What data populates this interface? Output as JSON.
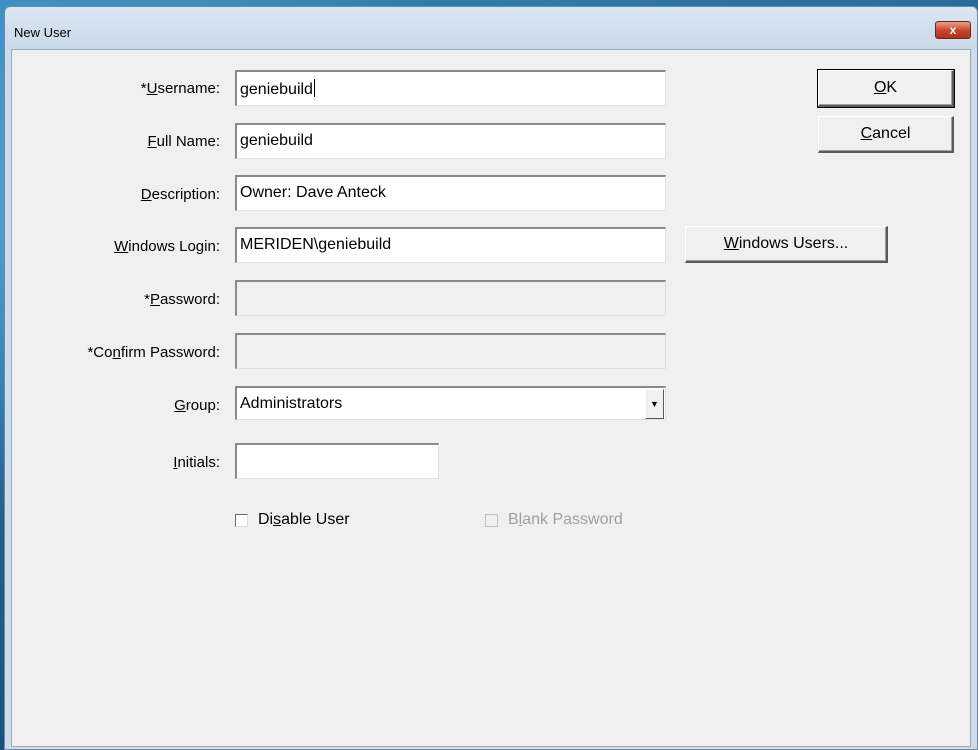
{
  "window": {
    "title": "New User",
    "close_label": "x"
  },
  "form": {
    "username": {
      "label_pre": "*",
      "label_ul": "U",
      "label_post": "sername:",
      "value": "geniebuild"
    },
    "full_name": {
      "label_pre": "",
      "label_ul": "F",
      "label_post": "ull Name:",
      "value": "geniebuild"
    },
    "description": {
      "label_pre": "",
      "label_ul": "D",
      "label_post": "escription:",
      "value": "Owner: Dave Anteck"
    },
    "windows_login": {
      "label_pre": "",
      "label_ul": "W",
      "label_post": "indows Login:",
      "value": "MERIDEN\\geniebuild"
    },
    "password": {
      "label_pre": "*",
      "label_ul": "P",
      "label_post": "assword:",
      "value": ""
    },
    "confirm_password": {
      "label_pre": "*Co",
      "label_ul": "n",
      "label_post": "firm Password:",
      "value": ""
    },
    "group": {
      "label_pre": "",
      "label_ul": "G",
      "label_post": "roup:",
      "value": "Administrators"
    },
    "initials": {
      "label_pre": "",
      "label_ul": "I",
      "label_post": "nitials:",
      "value": ""
    }
  },
  "buttons": {
    "ok": {
      "pre": "",
      "ul": "O",
      "post": "K"
    },
    "cancel": {
      "pre": "",
      "ul": "C",
      "post": "ancel"
    },
    "windows_users": {
      "pre": "",
      "ul": "W",
      "post": "indows Users..."
    }
  },
  "checkboxes": {
    "disable_user": {
      "pre": "Di",
      "ul": "s",
      "post": "able User",
      "checked": false,
      "enabled": true
    },
    "blank_password": {
      "pre": "B",
      "ul": "l",
      "post": "ank Password",
      "checked": false,
      "enabled": false
    }
  }
}
